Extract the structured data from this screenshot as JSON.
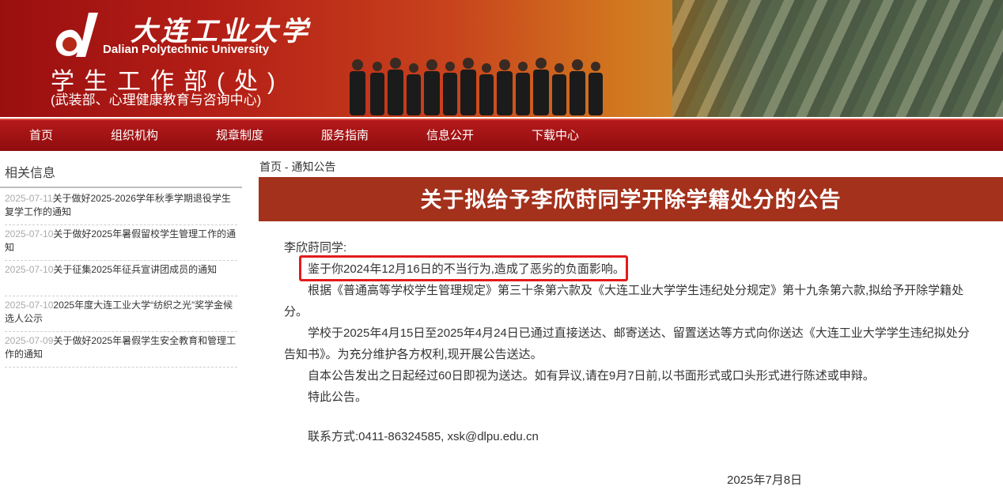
{
  "header": {
    "school_cn": "大连工业大学",
    "school_en": "Dalian Polytechnic University",
    "department": "学生工作部(处)",
    "department_sub": "(武装部、心理健康教育与咨询中心)"
  },
  "nav": {
    "items": [
      "首页",
      "组织机构",
      "规章制度",
      "服务指南",
      "信息公开",
      "下载中心"
    ]
  },
  "sidebar": {
    "title": "相关信息",
    "items": [
      {
        "date": "2025-07-11",
        "text": "关于做好2025-2026学年秋季学期退役学生复学工作的通知"
      },
      {
        "date": "2025-07-10",
        "text": "关于做好2025年暑假留校学生管理工作的通知"
      },
      {
        "date": "2025-07-10",
        "text": "关于征集2025年征兵宣讲团成员的通知"
      },
      {
        "date": "2025-07-10",
        "text": "2025年度大连工业大学“纺织之光”奖学金候选人公示"
      },
      {
        "date": "2025-07-09",
        "text": "关于做好2025年暑假学生安全教育和管理工作的通知"
      }
    ]
  },
  "breadcrumb": {
    "home": "首页",
    "separator": " - ",
    "current": "通知公告"
  },
  "article": {
    "title": "关于拟给予李欣莳同学开除学籍处分的公告",
    "salutation": "李欣莳同学:",
    "paragraphs": [
      "鉴于你2024年12月16日的不当行为,造成了恶劣的负面影响。",
      "根据《普通高等学校学生管理规定》第三十条第六款及《大连工业大学学生违纪处分规定》第十九条第六款,拟给予开除学籍处分。",
      "学校于2025年4月15日至2025年4月24日已通过直接送达、邮寄送达、留置送达等方式向你送达《大连工业大学学生违纪拟处分告知书》。为充分维护各方权利,现开展公告送达。",
      "自本公告发出之日起经过60日即视为送达。如有异议,请在9月7日前,以书面形式或口头形式进行陈述或申辩。",
      "特此公告。"
    ],
    "contact": "联系方式:0411-86324585, xsk@dlpu.edu.cn",
    "date": "2025年7月8日"
  },
  "colors": {
    "nav_bg": "#a3151a",
    "title_bar_bg": "#a3311c",
    "highlight_border": "#e31b1b"
  }
}
